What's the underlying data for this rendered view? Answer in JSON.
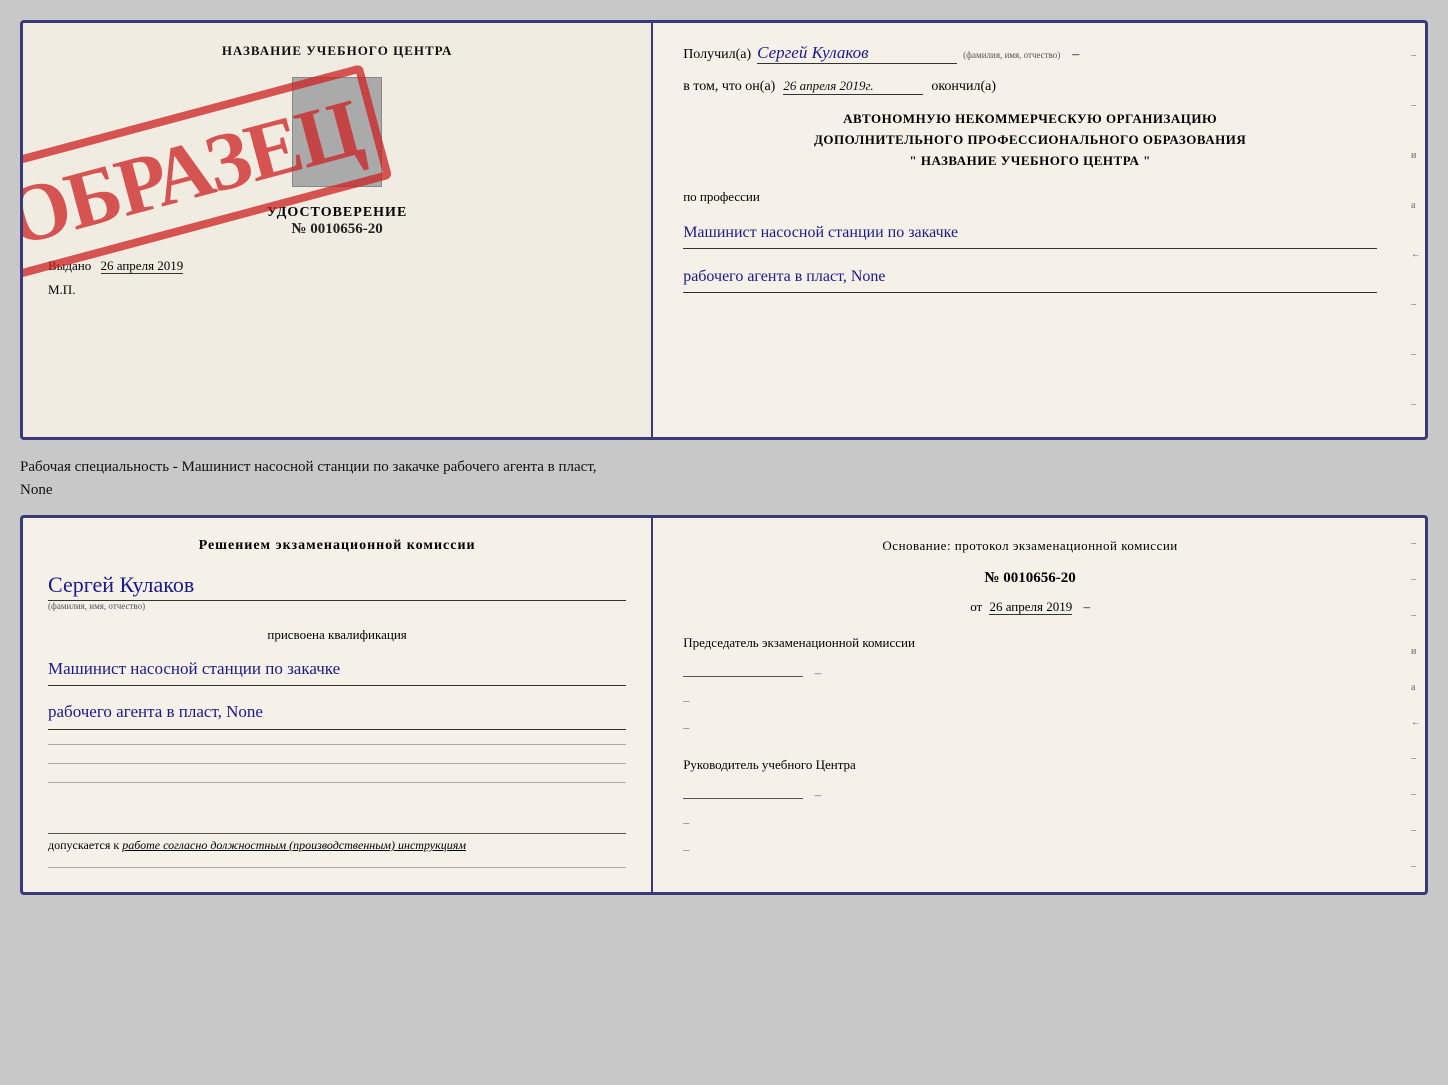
{
  "cert_top": {
    "left": {
      "title": "НАЗВАНИЕ УЧЕБНОГО ЦЕНТРА",
      "udostoverenie_label": "УДОСТОВЕРЕНИЕ",
      "number": "№ 0010656-20",
      "vydano_label": "Выдано",
      "vydano_date": "26 апреля 2019",
      "mp_label": "М.П."
    },
    "stamp": {
      "text": "ОБРАЗЕЦ"
    },
    "right": {
      "poluchil_label": "Получил(а)",
      "recipient_name": "Сергей Кулаков",
      "name_hint": "(фамилия, имя, отчество)",
      "dash": "–",
      "vtom_label": "в том, что он(а)",
      "date_value": "26 апреля 2019г.",
      "okonchil_label": "окончил(а)",
      "org_line1": "АВТОНОМНУЮ НЕКОММЕРЧЕСКУЮ ОРГАНИЗАЦИЮ",
      "org_line2": "ДОПОЛНИТЕЛЬНОГО ПРОФЕССИОНАЛЬНОГО ОБРАЗОВАНИЯ",
      "org_name": "\" НАЗВАНИЕ УЧЕБНОГО ЦЕНТРА \"",
      "profession_label": "по профессии",
      "profession_line1": "Машинист насосной станции по закачке",
      "profession_line2": "рабочего агента в пласт, None"
    }
  },
  "subtitle": {
    "line1": "Рабочая специальность - Машинист насосной станции по закачке рабочего агента в пласт,",
    "line2": "None"
  },
  "cert_bottom": {
    "left": {
      "komissia_title": "Решением экзаменационной комиссии",
      "person_name": "Сергей Кулаков",
      "name_hint": "(фамилия, имя, отчество)",
      "prisvoena_label": "присвоена квалификация",
      "qualification_line1": "Машинист насосной станции по закачке",
      "qualification_line2": "рабочего агента в пласт, None",
      "dopuskaetsya_prefix": "допускается к",
      "dopuskaetsya_text": "работе согласно должностным (производственным) инструкциям"
    },
    "right": {
      "osnovanie_label": "Основание: протокол экзаменационной комиссии",
      "protocol_number": "№ 0010656-20",
      "ot_label": "от",
      "protocol_date": "26 апреля 2019",
      "predsedatel_label": "Председатель экзаменационной комиссии",
      "rukovoditel_label": "Руководитель учебного Центра"
    }
  }
}
